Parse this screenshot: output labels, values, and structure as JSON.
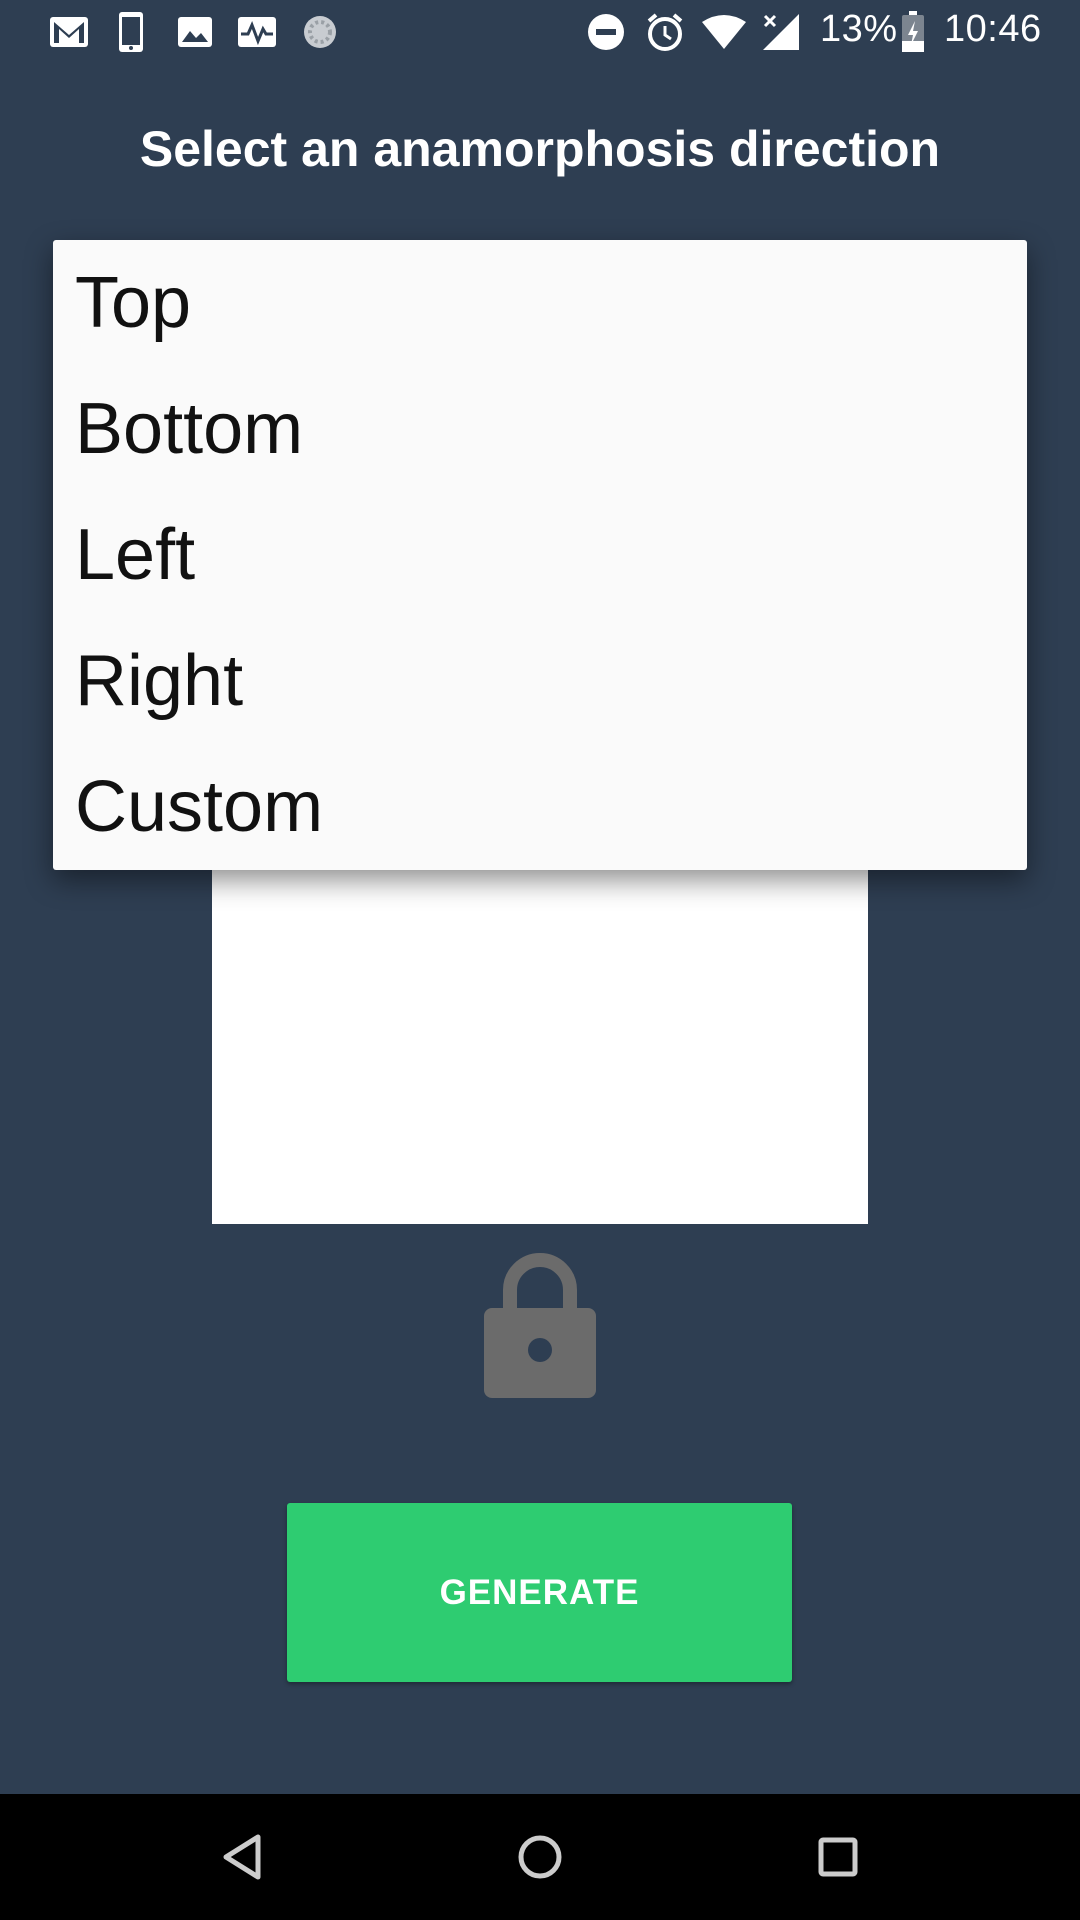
{
  "status_bar": {
    "battery": "13%",
    "time": "10:46",
    "icons": [
      "gmail-icon",
      "phone-icon",
      "image-icon",
      "activity-icon",
      "loading-icon",
      "dnd-icon",
      "alarm-icon",
      "wifi-icon",
      "signal-icon",
      "battery-icon"
    ]
  },
  "header": {
    "title": "Select an anamorphosis direction"
  },
  "dropdown": {
    "options": [
      "Top",
      "Bottom",
      "Left",
      "Right",
      "Custom"
    ]
  },
  "lock": {
    "icon": "lock-icon"
  },
  "actions": {
    "generate_label": "GENERATE"
  },
  "colors": {
    "background": "#2e3e52",
    "accent": "#2ecc71",
    "menu": "#fafafa"
  },
  "nav": {
    "icons": [
      "back-icon",
      "home-icon",
      "recents-icon"
    ]
  }
}
